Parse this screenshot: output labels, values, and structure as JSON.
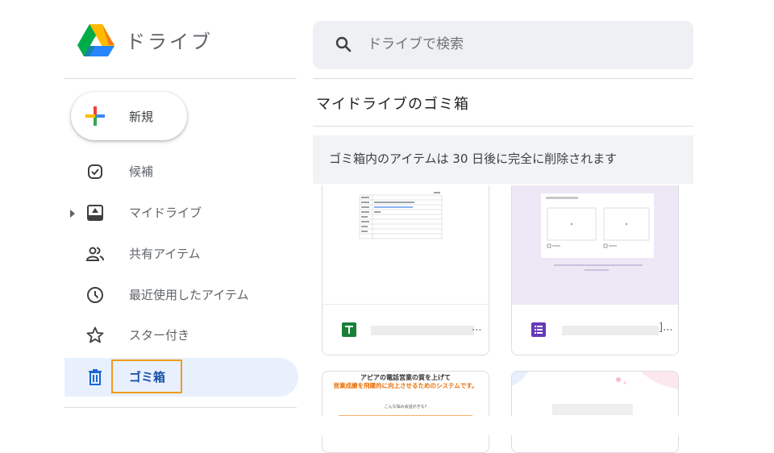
{
  "header": {
    "app_title": "ドライブ",
    "logo_icon": "google-drive-logo",
    "search": {
      "placeholder": "ドライブで検索",
      "value": "",
      "icon": "search-icon"
    }
  },
  "sidebar": {
    "new_button": {
      "label": "新規",
      "icon": "plus-icon"
    },
    "items": [
      {
        "label": "候補",
        "icon": "check-circle-icon"
      },
      {
        "label": "マイドライブ",
        "icon": "drive-folder-icon",
        "expandable": true
      },
      {
        "label": "共有アイテム",
        "icon": "people-icon"
      },
      {
        "label": "最近使用したアイテム",
        "icon": "clock-icon"
      },
      {
        "label": "スター付き",
        "icon": "star-icon"
      },
      {
        "label": "ゴミ箱",
        "icon": "trash-icon",
        "selected": true,
        "highlighted": true
      }
    ]
  },
  "main": {
    "title": "マイドライブのゴミ箱",
    "banner": "ゴミ箱内のアイテムは 30 日後に完全に削除されます",
    "files": [
      {
        "type": "sheets",
        "type_icon": "sheets-icon",
        "name_suffix": "..."
      },
      {
        "type": "forms",
        "type_icon": "forms-icon",
        "name_suffix": "]..."
      },
      {
        "type": "document",
        "preview_lines": [
          "アピアの電話営業の質を上げて",
          "営業成績を飛躍的に向上させるためのシステムです。",
          "こんな悩み会話がきな?"
        ]
      },
      {
        "type": "document"
      }
    ]
  },
  "colors": {
    "accent": "#1a73e8",
    "selected_bg": "#e8f0fe",
    "selected_text": "#174ea6",
    "highlight_border": "#f29b19",
    "sheets": "#188038",
    "forms": "#673ab7"
  }
}
